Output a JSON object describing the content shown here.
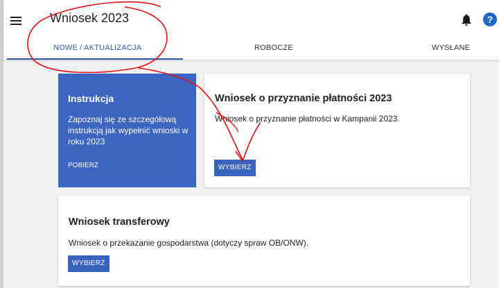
{
  "header": {
    "title": "Wniosek 2023",
    "menu_icon": "hamburger-menu-icon",
    "notification_icon": "bell-icon",
    "help_icon": "help-icon",
    "help_glyph": "?"
  },
  "tabs": [
    {
      "label": "NOWE / AKTUALIZACJA",
      "active": true
    },
    {
      "label": "ROBOCZE",
      "active": false
    },
    {
      "label": "WYSŁANE",
      "active": false
    }
  ],
  "instruction_card": {
    "title": "Instrukcja",
    "description": "Zapoznaj się ze szczegółową instrukcją jak wypełnić wnioski w roku 2023",
    "link": "POBIERZ"
  },
  "cards": [
    {
      "title": "Wniosek o przyznanie płatności 2023",
      "description": "Wniosek o przyznanie płatności w Kampanii 2023.",
      "button": "WYBIERZ"
    },
    {
      "title": "Wniosek transferowy",
      "description": "Wniosek o przekazanie gospodarstwa (dotyczy spraw OB/ONW).",
      "button": "WYBIERZ"
    }
  ],
  "colors": {
    "primary": "#3a62bf",
    "tab_active": "#2d5ab0",
    "background": "#f1f1f1",
    "annotation": "#e01010"
  }
}
